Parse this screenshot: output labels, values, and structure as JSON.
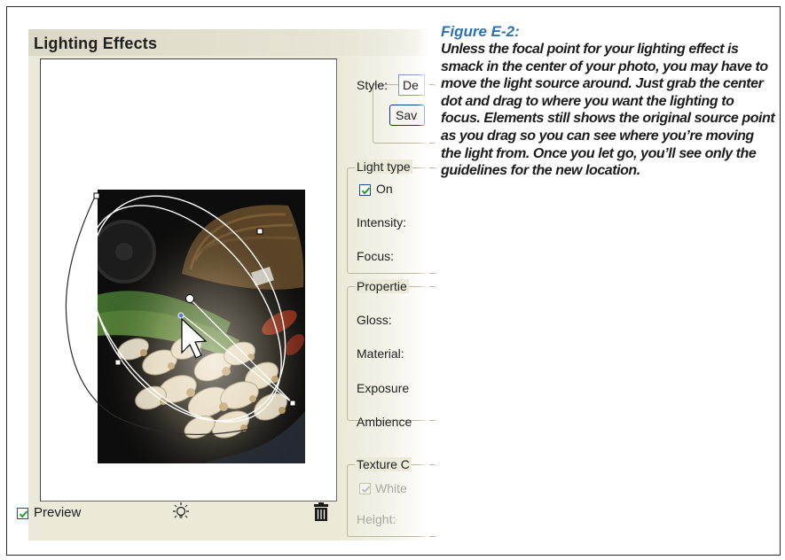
{
  "dialog": {
    "title": "Lighting Effects",
    "style_label": "Style:",
    "style_value": "De",
    "save_button": "Sav",
    "light_type_group": "Light type",
    "on_checkbox": {
      "label": "On",
      "checked": true
    },
    "intensity_label": "Intensity:",
    "focus_label": "Focus:",
    "properties_group": "Propertie",
    "gloss_label": "Gloss:",
    "material_label": "Material:",
    "exposure_label": "Exposure",
    "ambience_label": "Ambience",
    "texture_group": "Texture C",
    "white_checkbox": {
      "label": "White",
      "checked": true,
      "disabled": true
    },
    "height_label": "Height:",
    "preview_checkbox": {
      "label": "Preview",
      "checked": true
    },
    "icons": {
      "new_light": "light-bulb-icon",
      "delete_light": "trash-icon"
    }
  },
  "caption": {
    "title": "Figure E-2:",
    "body": "Unless the focal point for your lighting effect is smack in the center of your photo, you may have to move the light source around. Just grab the center dot and drag to where you want the lighting to focus. Elements still shows the original source point as you drag so you can see where you’re moving the light from. Once you let go, you’ll see only the guidelines for the new location."
  },
  "colors": {
    "caption_title": "#2a72b6",
    "dialog_bg": "#ece9d8",
    "checkbox_border": "#1c5180",
    "checkmark": "#21a121"
  }
}
